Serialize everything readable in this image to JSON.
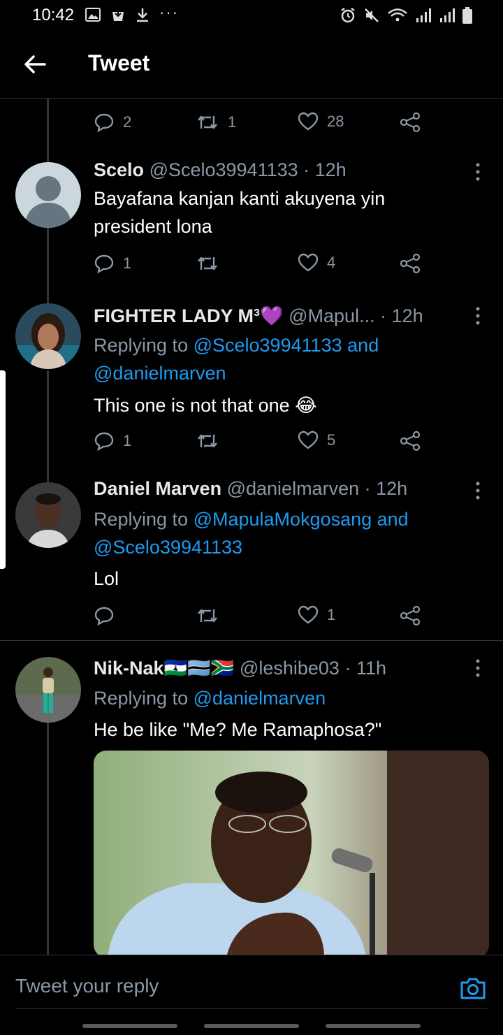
{
  "status_bar": {
    "time": "10:42",
    "more": "···"
  },
  "header": {
    "title": "Tweet"
  },
  "first_actions": {
    "replies": "2",
    "retweets": "1",
    "likes": "28"
  },
  "tweets": [
    {
      "name": "Scelo",
      "handle": "@Scelo39941133",
      "time": "· 12h",
      "text_line1": "Bayafana kanjan kanti akuyena yin",
      "text_line2": "president lona",
      "replies": "1",
      "retweets": "",
      "likes": "4"
    },
    {
      "name": "FIGHTER LADY M³💜",
      "handle": "@Mapul...",
      "time": "· 12h",
      "replying_label": "Replying to ",
      "replying_to_1": "@Scelo39941133 and",
      "replying_to_2": "@danielmarven",
      "text": "This one is not that one 😂",
      "replies": "1",
      "retweets": "",
      "likes": "5"
    },
    {
      "name": "Daniel Marven",
      "handle": "@danielmarven",
      "time": "· 12h",
      "replying_label": "Replying to ",
      "replying_to_1": "@MapulaMokgosang and",
      "replying_to_2": "@Scelo39941133",
      "text": "Lol",
      "replies": "",
      "retweets": "",
      "likes": "1"
    },
    {
      "name": "Nik-Nak🇱🇸🇧🇼🇿🇦",
      "handle": "@leshibe03",
      "time": "· 11h",
      "replying_label": "Replying to ",
      "replying_to_1": "@danielmarven",
      "text": "He be like \"Me? Me Ramaphosa?\""
    }
  ],
  "compose": {
    "placeholder": "Tweet your reply"
  },
  "icons": [
    "back-arrow-icon",
    "reply-icon",
    "retweet-icon",
    "like-icon",
    "share-icon",
    "more-icon",
    "camera-icon"
  ],
  "colors": {
    "background": "#000000",
    "accent": "#1d9bf0",
    "secondary_text": "#8b98a5"
  }
}
